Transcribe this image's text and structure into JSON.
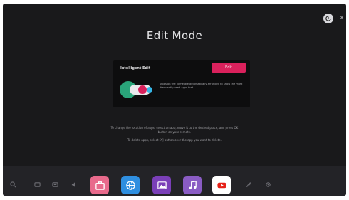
{
  "header": {
    "title": "Edit Mode",
    "exit_icon": "exit-icon",
    "close_icon": "close-icon"
  },
  "card": {
    "title": "Intelligent Edit",
    "button_label": "Edit",
    "description": "Apps on the home are automatically arranged to show the most frequently used apps first."
  },
  "help": {
    "line1": "To change the location of apps, select an app, move it to the desired place, and press OK",
    "line1b": "button on your remote.",
    "line2": "To delete apps, select [X] button over the app you want to delete."
  },
  "launcher": {
    "tools": [
      "search-icon",
      "input-icon",
      "settings-icon",
      "sound-icon"
    ],
    "apps": [
      {
        "name": "app-briefcase",
        "icon": "briefcase-icon",
        "color": "#e86a8c"
      },
      {
        "name": "app-browser",
        "icon": "globe-icon",
        "color": "#2f8fe0"
      },
      {
        "name": "app-gallery",
        "icon": "image-icon",
        "color": "#7a3fb8"
      },
      {
        "name": "app-music",
        "icon": "music-icon",
        "color": "#8a5cc4"
      },
      {
        "name": "app-youtube",
        "icon": "youtube-icon",
        "color": "#ffffff"
      }
    ],
    "trailing": [
      "edit-pencil-icon",
      "settings-gear-icon"
    ]
  },
  "colors": {
    "background": "#19191b",
    "card": "#0d0d0e",
    "accent": "#d9215c",
    "launcher": "#232327"
  }
}
